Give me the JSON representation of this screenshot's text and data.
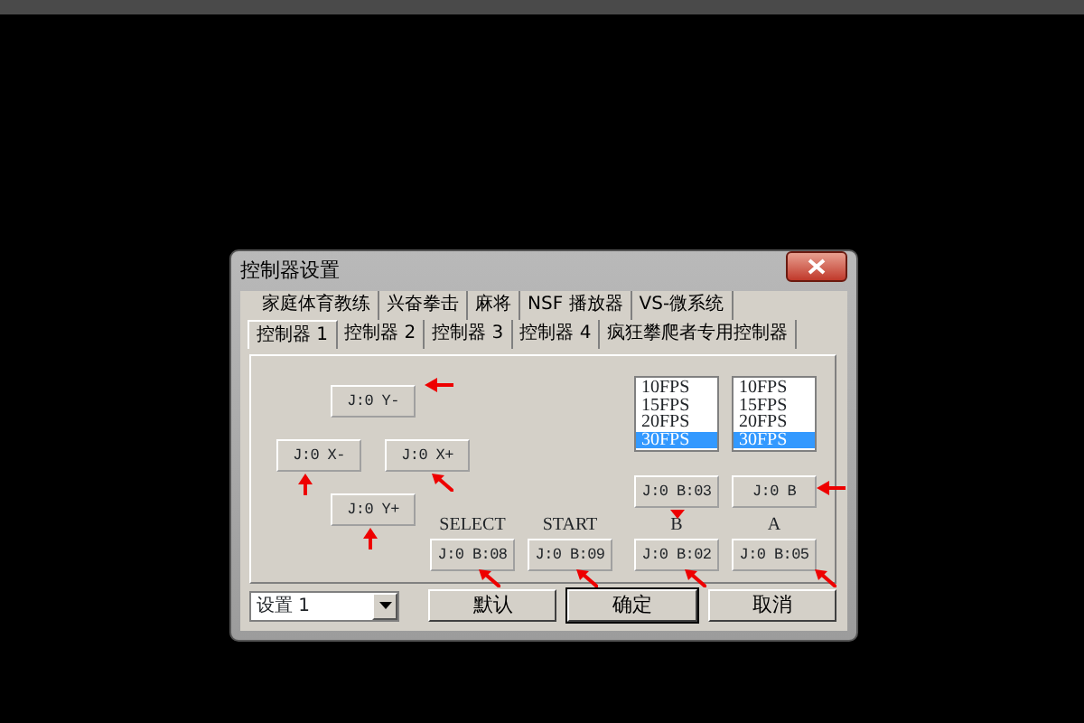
{
  "window": {
    "title": "控制器设置"
  },
  "tabs_row_1": [
    {
      "label": "家庭体育教练",
      "selected": false
    },
    {
      "label": "兴奋拳击",
      "selected": false
    },
    {
      "label": "麻将",
      "selected": false
    },
    {
      "label": "NSF 播放器",
      "selected": false
    },
    {
      "label": "VS-微系统",
      "selected": false
    }
  ],
  "tabs_row_2": [
    {
      "label": "控制器 1",
      "selected": true
    },
    {
      "label": "控制器 2",
      "selected": false
    },
    {
      "label": "控制器 3",
      "selected": false
    },
    {
      "label": "控制器 4",
      "selected": false
    },
    {
      "label": "疯狂攀爬者专用控制器",
      "selected": false
    }
  ],
  "direction_bindings": [
    {
      "kind": "up",
      "value": "J:0 Y-"
    },
    {
      "kind": "left",
      "value": "J:0 X-"
    },
    {
      "kind": "right",
      "value": "J:0 X+"
    },
    {
      "kind": "down",
      "value": "J:0 Y+"
    }
  ],
  "fps_lists": [
    {
      "options": [
        {
          "label": "10FPS",
          "selected": false
        },
        {
          "label": "15FPS",
          "selected": false
        },
        {
          "label": "20FPS",
          "selected": false
        },
        {
          "label": "30FPS",
          "selected": true
        }
      ]
    },
    {
      "options": [
        {
          "label": "10FPS",
          "selected": false
        },
        {
          "label": "15FPS",
          "selected": false
        },
        {
          "label": "20FPS",
          "selected": false
        },
        {
          "label": "30FPS",
          "selected": true
        }
      ]
    }
  ],
  "turbo_bindings": [
    "J:0 B:03",
    "J:0 B"
  ],
  "button_bindings": [
    {
      "label": "SELECT",
      "value": "J:0 B:08"
    },
    {
      "label": "START",
      "value": "J:0 B:09"
    },
    {
      "label": "B",
      "value": "J:0 B:02"
    },
    {
      "label": "A",
      "value": "J:0 B:05"
    }
  ],
  "profile": {
    "value": "设置 1"
  },
  "buttons": [
    "默认",
    "确定",
    "取消"
  ]
}
